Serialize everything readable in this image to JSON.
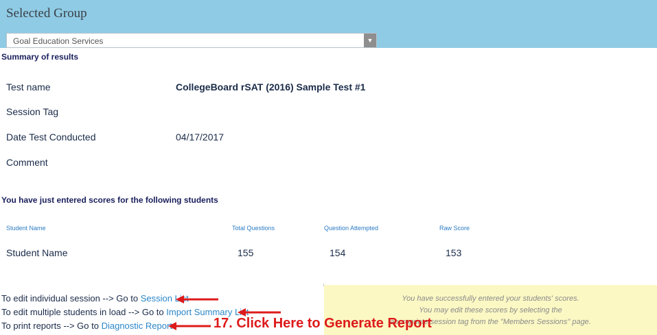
{
  "header": {
    "title": "Selected Group",
    "group_select": {
      "value": "Goal Education Services"
    }
  },
  "summary": {
    "heading": "Summary of results",
    "rows": [
      {
        "label": "Test name",
        "value": "CollegeBoard rSAT (2016) Sample Test #1"
      },
      {
        "label": "Session Tag",
        "value": ""
      },
      {
        "label": "Date Test Conducted",
        "value": "04/17/2017"
      },
      {
        "label": "Comment",
        "value": ""
      }
    ]
  },
  "students": {
    "heading": "You have just entered scores for the following students",
    "columns": [
      "Student Name",
      "Total Questions",
      "Question Attempted",
      "Raw Score"
    ],
    "rows": [
      [
        "Student Name",
        "155",
        "154",
        "153"
      ]
    ]
  },
  "links": [
    {
      "prefix": "To edit individual session --> Go to ",
      "link": "Session List"
    },
    {
      "prefix": "To edit multiple students in load --> Go to ",
      "link": "Import Summary List"
    },
    {
      "prefix": "To print reports --> Go to ",
      "link": "Diagnostic Reports"
    }
  ],
  "notice": {
    "lines": [
      "You have successfully entered your students' scores.",
      "You may edit these scores by selecting the",
      "appropriate session tag from the \"Members Sessions\" page."
    ]
  },
  "annotation": {
    "callout": "17. Click Here to Generate Report",
    "color": "#dd1a1a"
  }
}
